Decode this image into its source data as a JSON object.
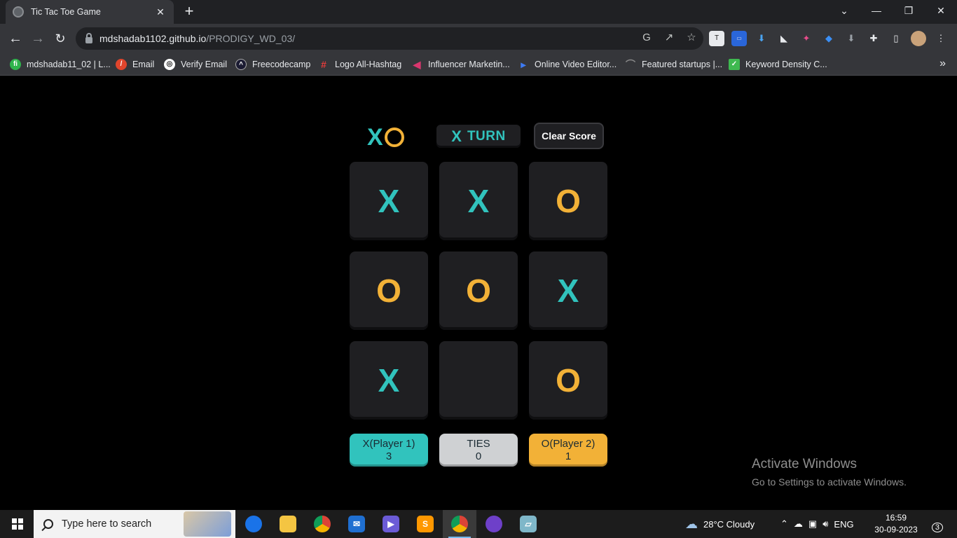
{
  "browser": {
    "tab_title": "Tic Tac Toe Game",
    "tab_close": "✕",
    "new_tab": "+",
    "window_controls": [
      "⌄",
      "—",
      "❐",
      "✕"
    ],
    "url_host": "mdshadab1102.github.io",
    "url_path": "/PRODIGY_WD_03/",
    "bookmarks": [
      {
        "label": "mdshadab11_02 | L...",
        "color": "#2fb44c"
      },
      {
        "label": "Email",
        "color": "#e0452c"
      },
      {
        "label": "Verify Email",
        "color": "#ffffff"
      },
      {
        "label": "Freecodecamp",
        "color": "#1b1b32"
      },
      {
        "label": "Logo All-Hashtag",
        "color": "#e23b3b"
      },
      {
        "label": "Influencer Marketin...",
        "color": "#d9366e"
      },
      {
        "label": "Online Video Editor...",
        "color": "#3d7bf5"
      },
      {
        "label": "Featured startups |...",
        "color": "#555555"
      },
      {
        "label": "Keyword Density C...",
        "color": "#3fb950"
      }
    ],
    "bookmarks_more": "»"
  },
  "game": {
    "logo_x": "X",
    "turn_mark": "X",
    "turn_label": "TURN",
    "clear_label": "Clear Score",
    "board": [
      "X",
      "X",
      "O",
      "O",
      "O",
      "X",
      "X",
      "",
      "O"
    ],
    "scores": {
      "x_label": "X(Player 1)",
      "x_value": "3",
      "ties_label": "TIES",
      "ties_value": "0",
      "o_label": "O(Player 2)",
      "o_value": "1"
    },
    "colors": {
      "x": "#31c3bd",
      "o": "#f2b137",
      "ties": "#cfd1d3",
      "cell": "#1f1f22"
    }
  },
  "watermark": {
    "line1": "Activate Windows",
    "line2": "Go to Settings to activate Windows."
  },
  "taskbar": {
    "search_placeholder": "Type here to search",
    "weather": "28°C  Cloudy",
    "language": "ENG",
    "time": "16:59",
    "date": "30-09-2023",
    "notifications": "3"
  }
}
